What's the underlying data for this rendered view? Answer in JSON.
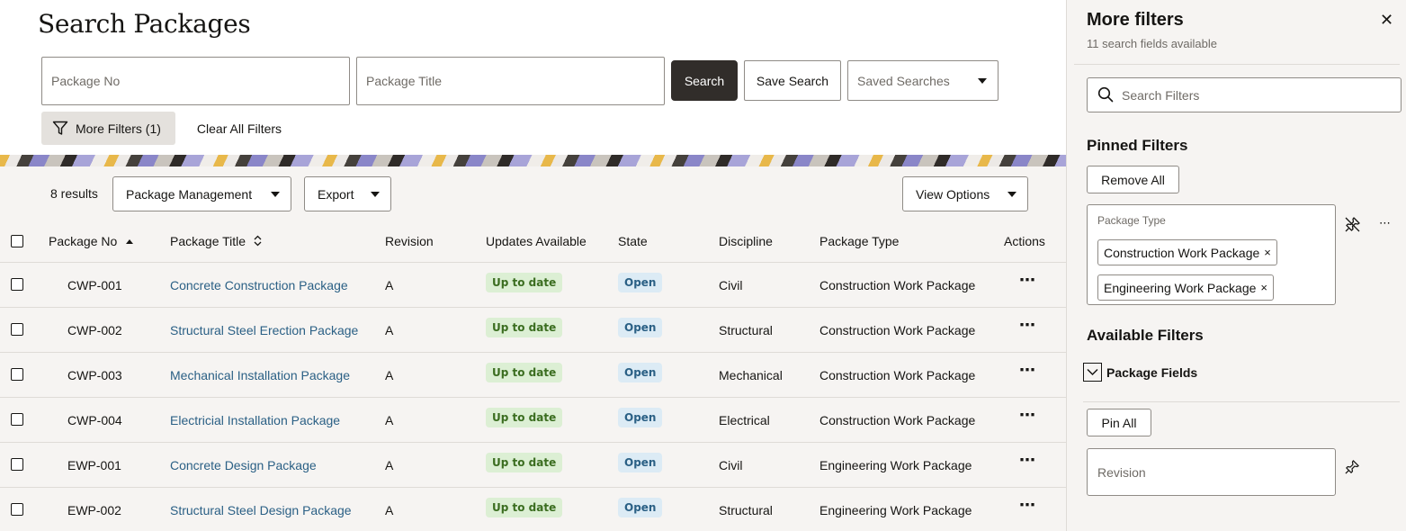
{
  "page": {
    "title": "Search Packages"
  },
  "search": {
    "package_no_placeholder": "Package No",
    "package_title_placeholder": "Package Title",
    "search_label": "Search",
    "save_search_label": "Save Search",
    "saved_searches_placeholder": "Saved Searches",
    "more_filters_label": "More Filters (1)",
    "clear_all_label": "Clear All Filters"
  },
  "toolbar": {
    "results_count": "8 results",
    "package_management_label": "Package Management",
    "export_label": "Export",
    "view_options_label": "View Options"
  },
  "table": {
    "columns": {
      "package_no": "Package No",
      "package_title": "Package Title",
      "revision": "Revision",
      "updates_available": "Updates Available",
      "state": "State",
      "discipline": "Discipline",
      "package_type": "Package Type",
      "actions": "Actions"
    },
    "rows": [
      {
        "no": "CWP-001",
        "title": "Concrete Construction Package",
        "revision": "A",
        "updates": "Up to date",
        "state": "Open",
        "discipline": "Civil",
        "type": "Construction Work Package"
      },
      {
        "no": "CWP-002",
        "title": "Structural Steel Erection Package",
        "revision": "A",
        "updates": "Up to date",
        "state": "Open",
        "discipline": "Structural",
        "type": "Construction Work Package"
      },
      {
        "no": "CWP-003",
        "title": "Mechanical Installation Package",
        "revision": "A",
        "updates": "Up to date",
        "state": "Open",
        "discipline": "Mechanical",
        "type": "Construction Work Package"
      },
      {
        "no": "CWP-004",
        "title": "Electricial Installation Package",
        "revision": "A",
        "updates": "Up to date",
        "state": "Open",
        "discipline": "Electrical",
        "type": "Construction Work Package"
      },
      {
        "no": "EWP-001",
        "title": "Concrete Design Package",
        "revision": "A",
        "updates": "Up to date",
        "state": "Open",
        "discipline": "Civil",
        "type": "Engineering Work Package"
      },
      {
        "no": "EWP-002",
        "title": "Structural Steel Design Package",
        "revision": "A",
        "updates": "Up to date",
        "state": "Open",
        "discipline": "Structural",
        "type": "Engineering Work Package"
      }
    ],
    "actions_glyph": "⋯"
  },
  "panel": {
    "title": "More filters",
    "subtitle": "11 search fields available",
    "close_glyph": "✕",
    "search_filters_placeholder": "Search Filters",
    "pinned_heading": "Pinned Filters",
    "remove_all_label": "Remove All",
    "pinned_field_label": "Package Type",
    "pinned_chips": [
      "Construction Work Package",
      "Engineering Work Package"
    ],
    "chip_remove_glyph": "×",
    "drag_glyph": "⋯",
    "available_heading": "Available Filters",
    "group_label": "Package Fields",
    "pin_all_label": "Pin All",
    "revision_placeholder": "Revision"
  },
  "colors": {
    "primary_button": "#312d2a",
    "link": "#2b6085",
    "badge_green_bg": "#dcefd4",
    "badge_green_text": "#3b6d20",
    "badge_blue_bg": "#dcebf5",
    "panel_bg": "#f6f4f2"
  },
  "icons": {
    "filter": "funnel-icon",
    "search": "magnifier-icon",
    "pin": "pushpin-icon",
    "unpin": "pushpin-slash-icon",
    "expand": "chevron-down-icon",
    "drag": "drag-handle-icon"
  }
}
